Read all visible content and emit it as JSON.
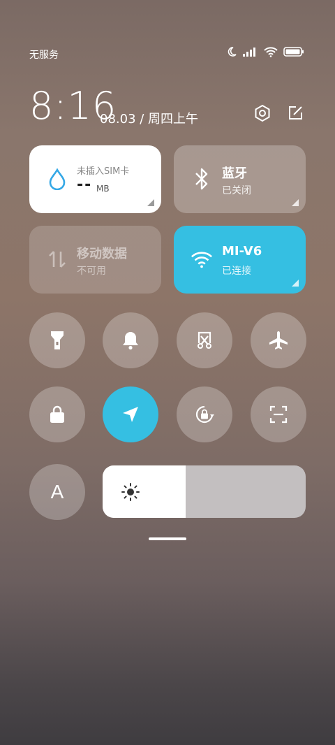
{
  "status_bar": {
    "carrier": "无服务",
    "icons": [
      "moon-icon",
      "signal-icon",
      "wifi-icon",
      "battery-icon"
    ]
  },
  "header": {
    "time": "8:16",
    "date": "08.03 / 周四上午",
    "actions": [
      "settings-icon",
      "edit-icon"
    ]
  },
  "tiles": {
    "sim": {
      "title": "未插入SIM卡",
      "value": "--",
      "unit": "MB",
      "icon": "water-drop-icon"
    },
    "bluetooth": {
      "title": "蓝牙",
      "status": "已关闭",
      "icon": "bluetooth-icon"
    },
    "mobile_data": {
      "title": "移动数据",
      "status": "不可用",
      "icon": "data-arrows-icon"
    },
    "wifi": {
      "title": "MI-V6",
      "status": "已连接",
      "icon": "wifi-icon"
    }
  },
  "toggles": [
    {
      "name": "flashlight",
      "icon": "flashlight-icon",
      "active": false
    },
    {
      "name": "notifications",
      "icon": "bell-icon",
      "active": false
    },
    {
      "name": "screenshot",
      "icon": "scissors-icon",
      "active": false
    },
    {
      "name": "airplane-mode",
      "icon": "airplane-icon",
      "active": false
    },
    {
      "name": "lock-screen",
      "icon": "lock-icon",
      "active": false
    },
    {
      "name": "location",
      "icon": "location-arrow-icon",
      "active": true
    },
    {
      "name": "rotation-lock",
      "icon": "rotation-lock-icon",
      "active": false
    },
    {
      "name": "scanner",
      "icon": "scan-icon",
      "active": false
    },
    {
      "name": "auto-brightness",
      "icon": "auto-brightness-icon",
      "label": "A",
      "active": false
    }
  ],
  "brightness": {
    "level": 0.41,
    "icon": "sun-icon"
  },
  "colors": {
    "accent": "#35bfe2",
    "tile_white": "#ffffff",
    "tile_translucent": "rgba(255,255,255,0.25)",
    "text_dark": "#222222",
    "text_grey": "#888888"
  }
}
